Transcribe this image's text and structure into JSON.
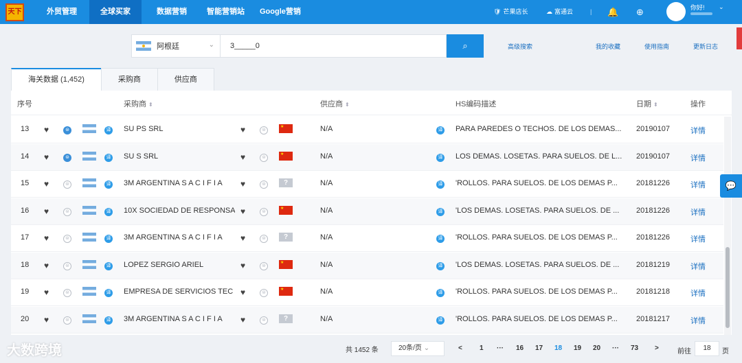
{
  "nav": {
    "items": [
      "外贸管理",
      "全球买家",
      "数据营销",
      "智能营销站",
      "Google营销"
    ],
    "active_index": 1,
    "right": {
      "manager": "芒果店长",
      "cloud": "富通云"
    },
    "user": {
      "greeting": "你好!"
    }
  },
  "search": {
    "country": "阿根廷",
    "query": "3_____0",
    "links": [
      "高级搜索",
      "我的收藏",
      "使用指南",
      "更新日志"
    ]
  },
  "tabs": [
    "海关数据 (1,452)",
    "采购商",
    "供应商"
  ],
  "table": {
    "headers": [
      "序号",
      "采购商",
      "供应商",
      "HS编码描述",
      "日期",
      "操作"
    ],
    "rows": [
      {
        "no": "13",
        "buyer": "SU          PS SRL",
        "buyer_icon": "blue",
        "origin": "cn",
        "supplier": "N/A",
        "hs": "PARA PAREDES O TECHOS. DE LOS DEMAS...",
        "date": "20190107",
        "action": "详情"
      },
      {
        "no": "14",
        "buyer": "SU          S SRL",
        "buyer_icon": "blue",
        "origin": "cn",
        "supplier": "N/A",
        "hs": "LOS DEMAS. LOSETAS. PARA SUELOS. DE L...",
        "date": "20190107",
        "action": "详情"
      },
      {
        "no": "15",
        "buyer": "3M ARGENTINA S A C I F I A",
        "buyer_icon": "grey",
        "origin": "unknown",
        "supplier": "N/A",
        "hs": "'ROLLOS. PARA SUELOS. DE LOS DEMAS P...",
        "date": "20181226",
        "action": "详情"
      },
      {
        "no": "16",
        "buyer": "10X SOCIEDAD DE RESPONSA",
        "buyer_icon": "grey",
        "origin": "cn",
        "supplier": "N/A",
        "hs": "'LOS DEMAS. LOSETAS. PARA SUELOS. DE ...",
        "date": "20181226",
        "action": "详情"
      },
      {
        "no": "17",
        "buyer": "3M ARGENTINA S A C I F I A",
        "buyer_icon": "grey",
        "origin": "unknown",
        "supplier": "N/A",
        "hs": "'ROLLOS. PARA SUELOS. DE LOS DEMAS P...",
        "date": "20181226",
        "action": "详情"
      },
      {
        "no": "18",
        "buyer": "LOPEZ SERGIO ARIEL",
        "buyer_icon": "grey",
        "origin": "cn",
        "supplier": "N/A",
        "hs": "'LOS DEMAS. LOSETAS. PARA SUELOS. DE ...",
        "date": "20181219",
        "action": "详情"
      },
      {
        "no": "19",
        "buyer": "EMPRESA DE SERVICIOS TEC",
        "buyer_icon": "grey",
        "origin": "cn",
        "supplier": "N/A",
        "hs": "'ROLLOS. PARA SUELOS. DE LOS DEMAS P...",
        "date": "20181218",
        "action": "详情"
      },
      {
        "no": "20",
        "buyer": "3M ARGENTINA S A C I F I A",
        "buyer_icon": "grey",
        "origin": "unknown",
        "supplier": "N/A",
        "hs": "'ROLLOS. PARA SUELOS. DE LOS DEMAS P...",
        "date": "20181217",
        "action": "详情"
      }
    ]
  },
  "pagination": {
    "total": "共 1452 条",
    "page_size": "20条/页",
    "pages": [
      "1",
      "···",
      "16",
      "17",
      "18",
      "19",
      "20",
      "···",
      "73"
    ],
    "current": "18",
    "goto_label": "前往",
    "goto_value": "18",
    "goto_suffix": "页"
  },
  "watermark": "大数跨境",
  "colors": {
    "primary": "#1a8ce0",
    "nav_active": "#0f6fc4"
  }
}
